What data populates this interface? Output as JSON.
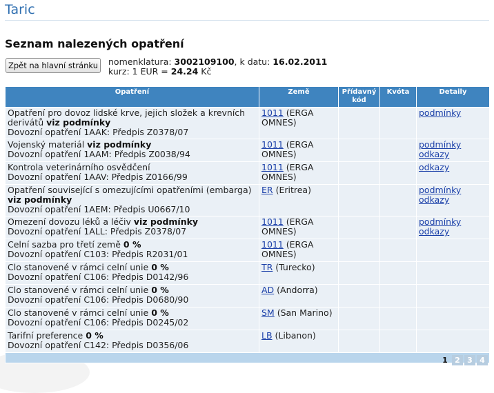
{
  "app": {
    "title": "Taric"
  },
  "page": {
    "title": "Seznam nalezených opatření"
  },
  "toolbar": {
    "back_label": "Zpět na hlavní stránku"
  },
  "info": {
    "nomenclature_label": "nomenklatura: ",
    "nomenclature_value": "3002109100",
    "date_label": ", k datu: ",
    "date_value": "16.02.2011",
    "rate_label": "kurz: 1 EUR = ",
    "rate_value": "24.24",
    "rate_currency": " Kč"
  },
  "table": {
    "headers": {
      "measure": "Opatření",
      "country": "Země",
      "additional_code": "Přídavný kód",
      "quota": "Kvóta",
      "details": "Detaily"
    },
    "rows": [
      {
        "measure": "Opatření pro dovoz lidské krve, jejich složek a krevních derivátů",
        "measure_strong": "viz podmínky",
        "sub": "Dovozní opatření 1AAK: Předpis Z0378/07",
        "country_code": "1011",
        "country_name": " (ERGA OMNES)",
        "detail1": "podmínky",
        "detail2": ""
      },
      {
        "measure": "Vojenský materiál",
        "measure_strong": "viz podmínky",
        "sub": "Dovozní opatření 1AAM: Předpis Z0038/94",
        "country_code": "1011",
        "country_name": " (ERGA OMNES)",
        "detail1": "podmínky",
        "detail2": "odkazy"
      },
      {
        "measure": "Kontrola veterinárního osvědčení",
        "measure_strong": "",
        "sub": "Dovozní opatření 1AAV: Předpis Z0166/99",
        "country_code": "1011",
        "country_name": " (ERGA OMNES)",
        "detail1": "odkazy",
        "detail2": ""
      },
      {
        "measure": "Opatření související s omezujícími opatřeními (embarga)",
        "measure_strong": "viz podmínky",
        "sub": "Dovozní opatření 1AEM: Předpis U0667/10",
        "country_code": "ER",
        "country_name": " (Eritrea)",
        "detail1": "podmínky",
        "detail2": "odkazy"
      },
      {
        "measure": "Omezení dovozu léků a léčiv",
        "measure_strong": "viz podmínky",
        "sub": "Dovozní opatření 1ALL: Předpis Z0378/07",
        "country_code": "1011",
        "country_name": " (ERGA OMNES)",
        "detail1": "podmínky",
        "detail2": "odkazy"
      },
      {
        "measure": "Celní sazba pro třetí země",
        "measure_strong": "0 %",
        "sub": "Dovozní opatření C103: Předpis R2031/01",
        "country_code": "1011",
        "country_name": " (ERGA OMNES)",
        "detail1": "",
        "detail2": ""
      },
      {
        "measure": "Clo stanovené v rámci celní unie",
        "measure_strong": "0 %",
        "sub": "Dovozní opatření C106: Předpis D0142/96",
        "country_code": "TR",
        "country_name": " (Turecko)",
        "detail1": "",
        "detail2": ""
      },
      {
        "measure": "Clo stanovené v rámci celní unie",
        "measure_strong": "0 %",
        "sub": "Dovozní opatření C106: Předpis D0680/90",
        "country_code": "AD",
        "country_name": " (Andorra)",
        "detail1": "",
        "detail2": ""
      },
      {
        "measure": "Clo stanovené v rámci celní unie",
        "measure_strong": "0 %",
        "sub": "Dovozní opatření C106: Předpis D0245/02",
        "country_code": "SM",
        "country_name": " (San Marino)",
        "detail1": "",
        "detail2": ""
      },
      {
        "measure": "Tarifní preference",
        "measure_strong": "0 %",
        "sub": "Dovozní opatření C142: Předpis D0356/06",
        "country_code": "LB",
        "country_name": " (Libanon)",
        "detail1": "",
        "detail2": ""
      }
    ]
  },
  "pagination": {
    "pages": [
      "1",
      "2",
      "3",
      "4"
    ],
    "current": "1"
  },
  "colors": {
    "header_bg": "#3f84bf",
    "row_bg": "#eaf0f6",
    "link": "#1a3fa8",
    "title": "#2f6fb0"
  }
}
